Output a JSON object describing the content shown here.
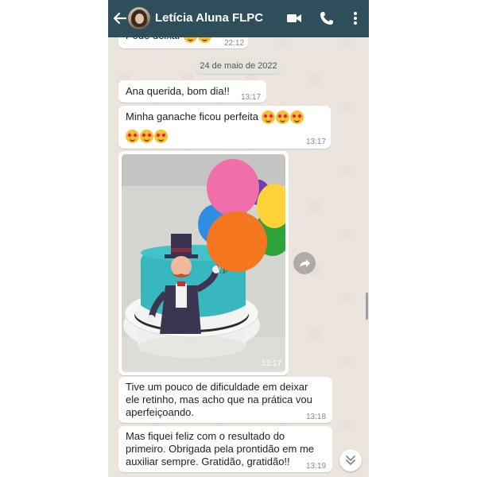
{
  "header": {
    "contact_name": "Letícia Aluna FLPC",
    "icons": [
      "back-arrow-icon",
      "video-call-icon",
      "voice-call-icon",
      "more-options-icon"
    ],
    "bar_color": "#2f4e5b"
  },
  "chat": {
    "partial_message": {
      "text": "Pode deixar",
      "time": "22:12"
    },
    "date_separator": "24 de maio de 2022",
    "messages": [
      {
        "text": "Ana querida, bom dia!!",
        "time": "13:17"
      },
      {
        "text": "Minha ganache ficou perfeita",
        "time": "13:17"
      },
      {
        "type": "image",
        "time": "13:17"
      },
      {
        "text_lines": [
          "Tive um pouco de dificuldade em deixar",
          "ele retinho, mas acho que na prática vou",
          "aperfeiçoando."
        ],
        "time": "13:18"
      },
      {
        "text_lines": [
          "Mas fiquei feliz com o resultado do",
          "primeiro. Obrigada pela prontidão em me",
          "auxiliar sempre. Gratidão, gratidão!!"
        ],
        "time": "13:19"
      }
    ]
  },
  "colors": {
    "chat_background": "#ece5dd",
    "bubble": "#ffffff"
  }
}
